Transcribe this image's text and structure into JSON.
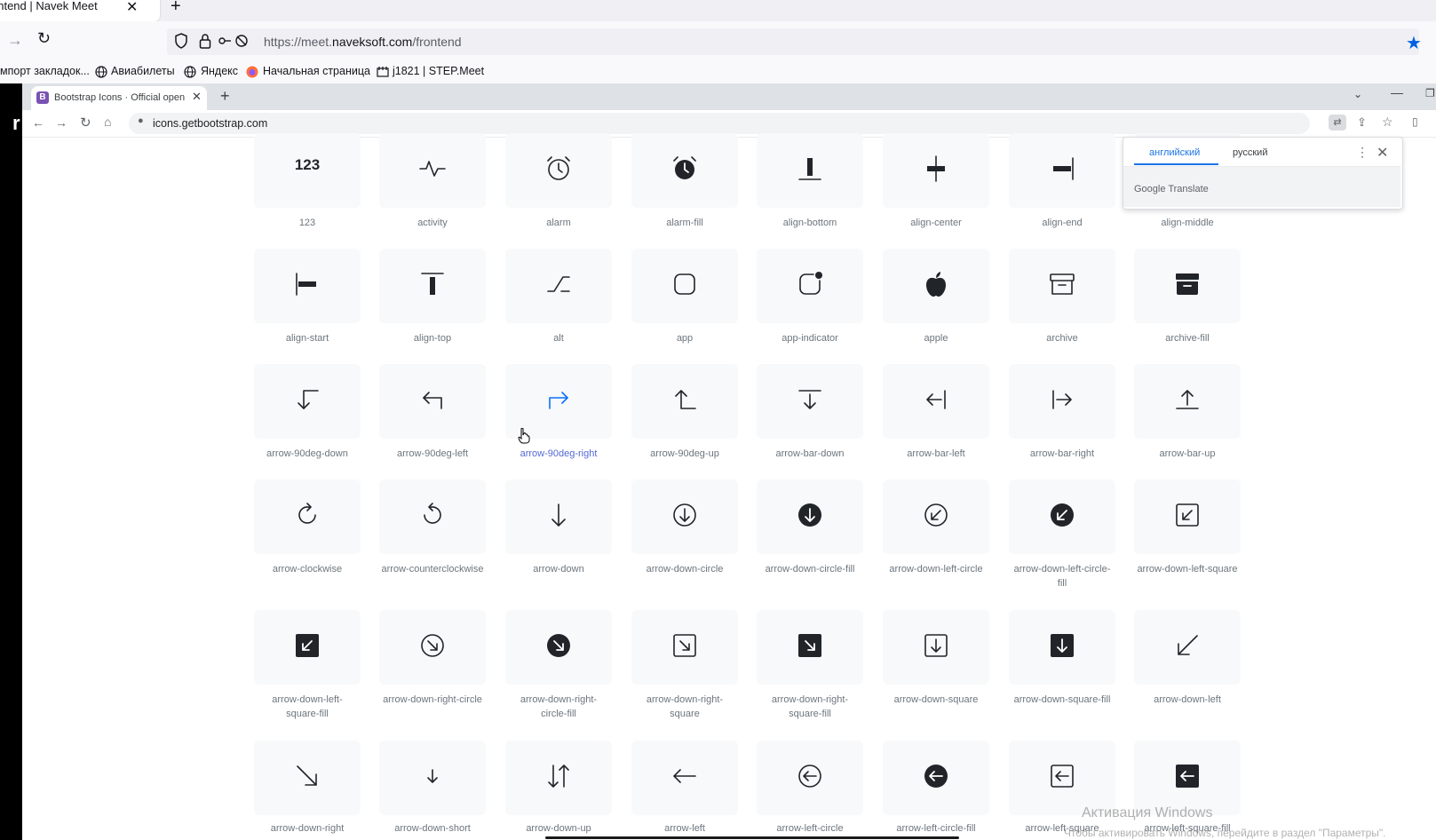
{
  "firefox": {
    "tab_title": "ontend | Navek Meet",
    "tab_close": "✕",
    "new_tab": "+",
    "url_prefix": "https://meet.",
    "url_domain": "naveksoft.com",
    "url_path": "/frontend",
    "bookmarks": [
      {
        "label": "мпорт закладок...",
        "icon": "none"
      },
      {
        "label": "Авиабилеты",
        "icon": "globe-icon"
      },
      {
        "label": "Яндекс",
        "icon": "globe-icon"
      },
      {
        "label": "Начальная страница",
        "icon": "firefox-icon"
      },
      {
        "label": "j1821 | STEP.Meet",
        "icon": "page-icon"
      }
    ]
  },
  "chrome": {
    "tab_title": "Bootstrap Icons · Official open so",
    "tab_favicon": "B",
    "tab_close": "✕",
    "new_tab": "+",
    "url": "icons.getbootstrap.com"
  },
  "translate": {
    "tab_source": "английский",
    "tab_target": "русский",
    "brand": "Google Translate"
  },
  "icon_grid": [
    [
      {
        "name": "123",
        "icon": "text-123"
      },
      {
        "name": "activity",
        "icon": "activity"
      },
      {
        "name": "alarm",
        "icon": "alarm"
      },
      {
        "name": "alarm-fill",
        "icon": "alarm-fill"
      },
      {
        "name": "align-bottom",
        "icon": "align-bottom"
      },
      {
        "name": "align-center",
        "icon": "align-center"
      },
      {
        "name": "align-end",
        "icon": "align-end"
      },
      {
        "name": "align-middle",
        "icon": "align-middle"
      }
    ],
    [
      {
        "name": "align-start",
        "icon": "align-start"
      },
      {
        "name": "align-top",
        "icon": "align-top"
      },
      {
        "name": "alt",
        "icon": "alt"
      },
      {
        "name": "app",
        "icon": "app"
      },
      {
        "name": "app-indicator",
        "icon": "app-indicator"
      },
      {
        "name": "apple",
        "icon": "apple"
      },
      {
        "name": "archive",
        "icon": "archive"
      },
      {
        "name": "archive-fill",
        "icon": "archive-fill"
      }
    ],
    [
      {
        "name": "arrow-90deg-down",
        "icon": "arrow-90deg-down"
      },
      {
        "name": "arrow-90deg-left",
        "icon": "arrow-90deg-left"
      },
      {
        "name": "arrow-90deg-right",
        "icon": "arrow-90deg-right",
        "active": true
      },
      {
        "name": "arrow-90deg-up",
        "icon": "arrow-90deg-up"
      },
      {
        "name": "arrow-bar-down",
        "icon": "arrow-bar-down"
      },
      {
        "name": "arrow-bar-left",
        "icon": "arrow-bar-left"
      },
      {
        "name": "arrow-bar-right",
        "icon": "arrow-bar-right"
      },
      {
        "name": "arrow-bar-up",
        "icon": "arrow-bar-up"
      }
    ],
    [
      {
        "name": "arrow-clockwise",
        "icon": "arrow-clockwise"
      },
      {
        "name": "arrow-counterclockwise",
        "icon": "arrow-counterclockwise"
      },
      {
        "name": "arrow-down",
        "icon": "arrow-down"
      },
      {
        "name": "arrow-down-circle",
        "icon": "arrow-down-circle"
      },
      {
        "name": "arrow-down-circle-fill",
        "icon": "arrow-down-circle-fill"
      },
      {
        "name": "arrow-down-left-circle",
        "icon": "arrow-down-left-circle"
      },
      {
        "name": "arrow-down-left-circle-\nfill",
        "icon": "arrow-down-left-circle-fill"
      },
      {
        "name": "arrow-down-left-square",
        "icon": "arrow-down-left-square"
      }
    ],
    [
      {
        "name": "arrow-down-left-\nsquare-fill",
        "icon": "arrow-down-left-square-fill"
      },
      {
        "name": "arrow-down-right-circle",
        "icon": "arrow-down-right-circle"
      },
      {
        "name": "arrow-down-right-\ncircle-fill",
        "icon": "arrow-down-right-circle-fill"
      },
      {
        "name": "arrow-down-right-\nsquare",
        "icon": "arrow-down-right-square"
      },
      {
        "name": "arrow-down-right-\nsquare-fill",
        "icon": "arrow-down-right-square-fill"
      },
      {
        "name": "arrow-down-square",
        "icon": "arrow-down-square"
      },
      {
        "name": "arrow-down-square-fill",
        "icon": "arrow-down-square-fill"
      },
      {
        "name": "arrow-down-left",
        "icon": "arrow-down-left"
      }
    ],
    [
      {
        "name": "arrow-down-right",
        "icon": "arrow-down-right"
      },
      {
        "name": "arrow-down-short",
        "icon": "arrow-down-short"
      },
      {
        "name": "arrow-down-up",
        "icon": "arrow-down-up"
      },
      {
        "name": "arrow-left",
        "icon": "arrow-left"
      },
      {
        "name": "arrow-left-circle",
        "icon": "arrow-left-circle"
      },
      {
        "name": "arrow-left-circle-fill",
        "icon": "arrow-left-circle-fill"
      },
      {
        "name": "arrow-left-square",
        "icon": "arrow-left-square"
      },
      {
        "name": "arrow-left-square-fill",
        "icon": "arrow-left-square-fill"
      }
    ]
  ],
  "windows_watermark": {
    "line1": "Активация Windows",
    "line2": "Чтобы активировать Windows, перейдите в раздел \"Параметры\"."
  },
  "colors": {
    "bootstrap_purple": "#7952b3",
    "active_label": "#5469d4",
    "firefox_star": "#0061e0",
    "translate_blue": "#1a73e8"
  }
}
